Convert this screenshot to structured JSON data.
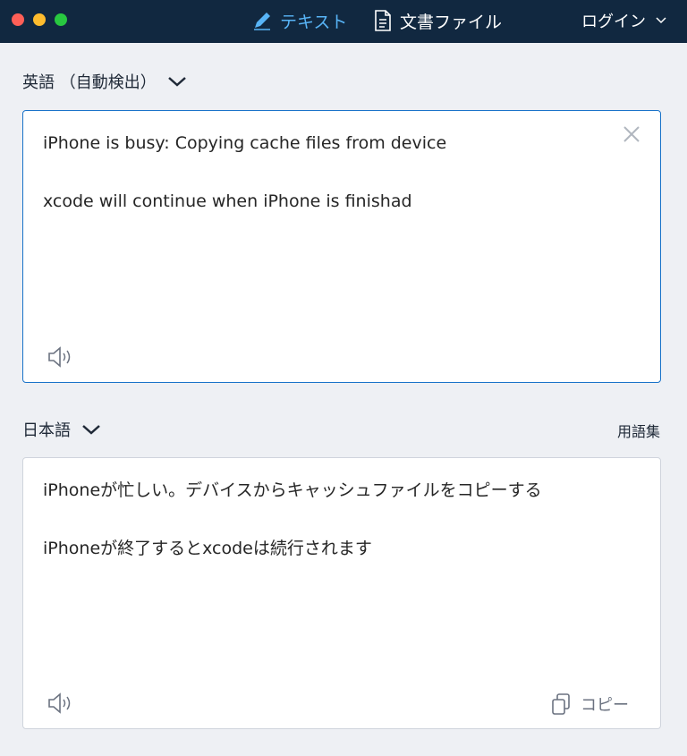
{
  "titlebar": {
    "tabs": [
      {
        "label": "テキスト",
        "icon": "pencil-icon",
        "active": true
      },
      {
        "label": "文書ファイル",
        "icon": "document-icon",
        "active": false
      }
    ],
    "login_label": "ログイン"
  },
  "source": {
    "language_label": "英語 （自動検出）",
    "lines": [
      "iPhone is busy: Copying cache files from device",
      "xcode will continue when iPhone is finishad"
    ]
  },
  "target": {
    "language_label": "日本語",
    "glossary_label": "用語集",
    "lines": [
      "iPhoneが忙しい。デバイスからキャッシュファイルをコピーする",
      "iPhoneが終了するとxcodeは続行されます"
    ],
    "copy_label": "コピー"
  },
  "colors": {
    "titlebar_bg": "#112840",
    "active_tab": "#58b4f6",
    "focus_border": "#1a73c9"
  }
}
